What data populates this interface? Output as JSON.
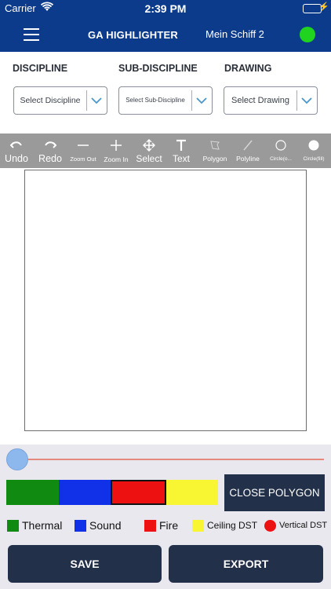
{
  "status_bar": {
    "carrier": "Carrier",
    "time": "2:39 PM",
    "charging_symbol": "⚡"
  },
  "header": {
    "title": "GA HIGHLIGHTER",
    "ship_name": "Mein Schiff 2",
    "menu_icon": "hamburger-icon",
    "status_color": "#1fd31f"
  },
  "filters": {
    "discipline": {
      "label": "DISCIPLINE",
      "value": "Select Discipline"
    },
    "sub_discipline": {
      "label": "SUB-DISCIPLINE",
      "value": "Select Sub-Discipline"
    },
    "drawing": {
      "label": "DRAWING",
      "value": "Select Drawing"
    }
  },
  "toolbar": {
    "undo": "Undo",
    "redo": "Redo",
    "zoom_out": "Zoom Out",
    "zoom_in": "Zoom In",
    "select": "Select",
    "text": "Text",
    "polygon": "Polygon",
    "polyline": "Polyline",
    "circle_outline": "Circle(o...",
    "circle_fill": "Circle(fill)"
  },
  "slider": {
    "value_fraction": 0.0
  },
  "swatches": [
    {
      "color": "#118a11",
      "selected": false
    },
    {
      "color": "#1131e8",
      "selected": false
    },
    {
      "color": "#ee1111",
      "selected": true
    },
    {
      "color": "#f8f532",
      "selected": false
    }
  ],
  "close_polygon_label": "CLOSE POLYGON",
  "legend": {
    "thermal": {
      "label": "Thermal",
      "color": "#118a11"
    },
    "sound": {
      "label": "Sound",
      "color": "#1131e8"
    },
    "fire": {
      "label": "Fire",
      "color": "#ee1111"
    },
    "ceiling_dst": {
      "label": "Ceiling DST",
      "color": "#f8f532"
    },
    "vertical_dst": {
      "label": "Vertical DST",
      "color": "#ee1111"
    }
  },
  "actions": {
    "save": "SAVE",
    "export": "EXPORT"
  },
  "colors": {
    "nav": "#0d3b8c",
    "button": "#23304a",
    "toolbar": "#9a9a9a",
    "accent_chevron": "#4a98c9"
  }
}
